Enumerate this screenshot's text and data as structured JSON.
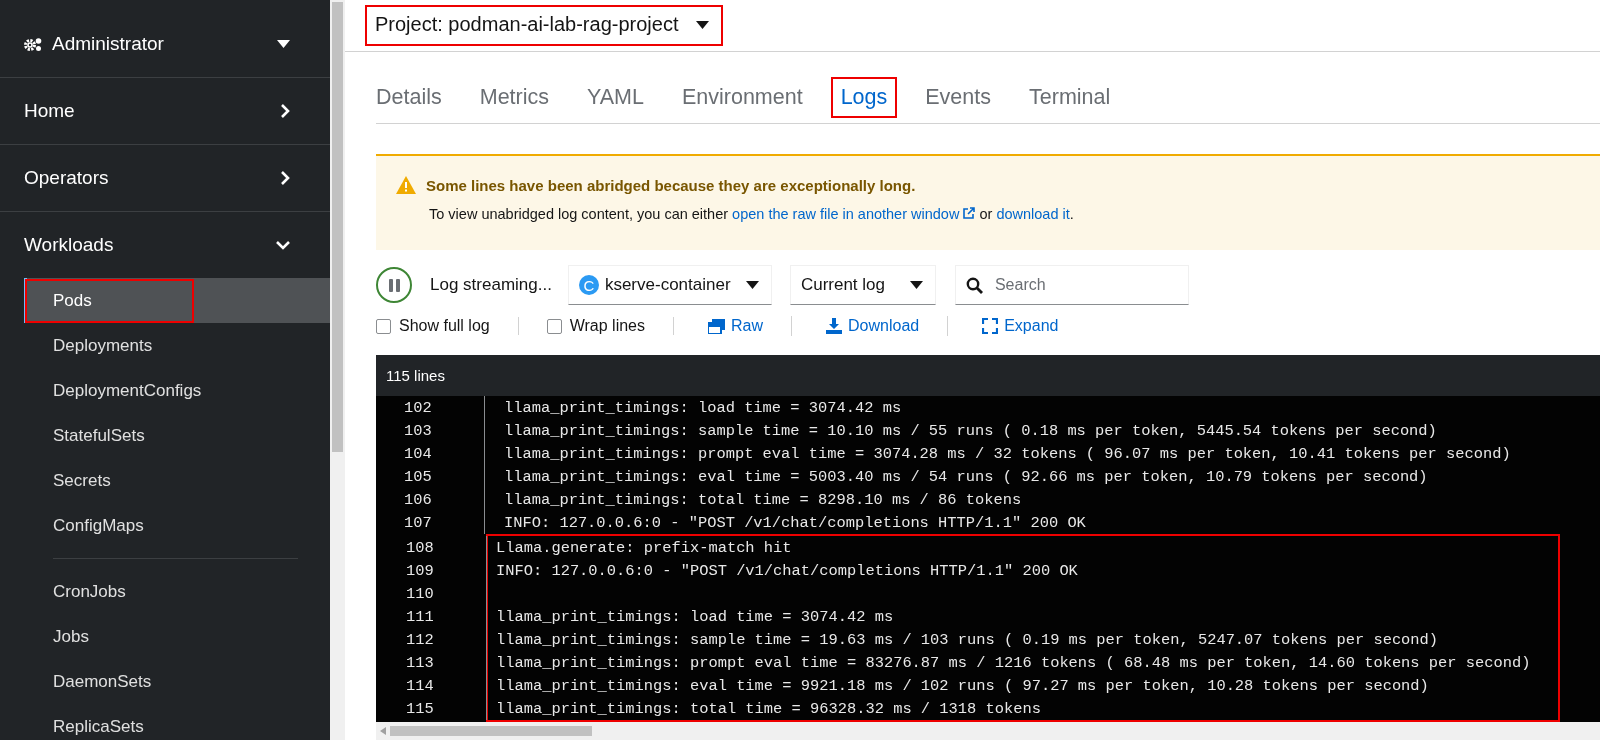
{
  "sidebar": {
    "perspective": {
      "label": "Administrator"
    },
    "sections": [
      {
        "label": "Home",
        "expanded": false
      },
      {
        "label": "Operators",
        "expanded": false
      },
      {
        "label": "Workloads",
        "expanded": true,
        "groups": [
          {
            "items": [
              {
                "label": "Pods",
                "selected": true,
                "highlighted": true
              },
              {
                "label": "Deployments",
                "selected": false,
                "highlighted": false
              },
              {
                "label": "DeploymentConfigs",
                "selected": false,
                "highlighted": false
              },
              {
                "label": "StatefulSets",
                "selected": false,
                "highlighted": false
              },
              {
                "label": "Secrets",
                "selected": false,
                "highlighted": false
              },
              {
                "label": "ConfigMaps",
                "selected": false,
                "highlighted": false
              }
            ]
          },
          {
            "items": [
              {
                "label": "CronJobs",
                "selected": false,
                "highlighted": false
              },
              {
                "label": "Jobs",
                "selected": false,
                "highlighted": false
              },
              {
                "label": "DaemonSets",
                "selected": false,
                "highlighted": false
              },
              {
                "label": "ReplicaSets",
                "selected": false,
                "highlighted": false
              }
            ]
          }
        ]
      }
    ]
  },
  "project": {
    "label": "Project: podman-ai-lab-rag-project",
    "highlighted": true
  },
  "tabs": [
    {
      "label": "Details",
      "selected": false,
      "highlighted": false
    },
    {
      "label": "Metrics",
      "selected": false,
      "highlighted": false
    },
    {
      "label": "YAML",
      "selected": false,
      "highlighted": false
    },
    {
      "label": "Environment",
      "selected": false,
      "highlighted": false
    },
    {
      "label": "Logs",
      "selected": true,
      "highlighted": true
    },
    {
      "label": "Events",
      "selected": false,
      "highlighted": false
    },
    {
      "label": "Terminal",
      "selected": false,
      "highlighted": false
    }
  ],
  "alert": {
    "title": "Some lines have been abridged because they are exceptionally long.",
    "message": [
      {
        "kind": "text",
        "text": "To view unabridged log content, you can either "
      },
      {
        "kind": "external-link",
        "text": "open the raw file in another window"
      },
      {
        "kind": "text",
        "text": " or "
      },
      {
        "kind": "link",
        "text": "download it"
      },
      {
        "kind": "text",
        "text": "."
      }
    ]
  },
  "toolbar": {
    "streaming_label": "Log streaming...",
    "container": {
      "badge": "C",
      "label": "kserve-container"
    },
    "log_select": "Current log",
    "search": {
      "placeholder": "Search"
    },
    "options": [
      {
        "kind": "checkbox",
        "label": "Show full log",
        "checked": false
      },
      {
        "kind": "checkbox",
        "label": "Wrap lines",
        "checked": false
      },
      {
        "kind": "raw",
        "label": "Raw"
      },
      {
        "kind": "download",
        "label": "Download"
      },
      {
        "kind": "expand",
        "label": "Expand"
      }
    ]
  },
  "log": {
    "count": "115 lines",
    "blocks": [
      {
        "highlighted": false,
        "lines": [
          {
            "number": "102",
            "text": "llama_print_timings: load time = 3074.42 ms"
          },
          {
            "number": "103",
            "text": "llama_print_timings: sample time = 10.10 ms / 55 runs ( 0.18 ms per token, 5445.54 tokens per second)"
          },
          {
            "number": "104",
            "text": "llama_print_timings: prompt eval time = 3074.28 ms / 32 tokens ( 96.07 ms per token, 10.41 tokens per second)"
          },
          {
            "number": "105",
            "text": "llama_print_timings: eval time = 5003.40 ms / 54 runs ( 92.66 ms per token, 10.79 tokens per second)"
          },
          {
            "number": "106",
            "text": "llama_print_timings: total time = 8298.10 ms / 86 tokens"
          },
          {
            "number": "107",
            "text": "INFO: 127.0.0.6:0 - \"POST /v1/chat/completions HTTP/1.1\" 200 OK"
          }
        ]
      },
      {
        "highlighted": true,
        "lines": [
          {
            "number": "108",
            "text": "Llama.generate: prefix-match hit"
          },
          {
            "number": "109",
            "text": "INFO: 127.0.0.6:0 - \"POST /v1/chat/completions HTTP/1.1\" 200 OK"
          },
          {
            "number": "110"
          },
          {
            "number": "111",
            "text": "llama_print_timings: load time = 3074.42 ms"
          },
          {
            "number": "112",
            "text": "llama_print_timings: sample time = 19.63 ms / 103 runs ( 0.19 ms per token, 5247.07 tokens per second)"
          },
          {
            "number": "113",
            "text": "llama_print_timings: prompt eval time = 83276.87 ms / 1216 tokens ( 68.48 ms per token, 14.60 tokens per second)"
          },
          {
            "number": "114",
            "text": "llama_print_timings: eval time = 9921.18 ms / 102 runs ( 97.27 ms per token, 10.28 tokens per second)"
          },
          {
            "number": "115",
            "text": "llama_print_timings: total time = 96328.32 ms / 1318 tokens"
          }
        ]
      }
    ]
  }
}
